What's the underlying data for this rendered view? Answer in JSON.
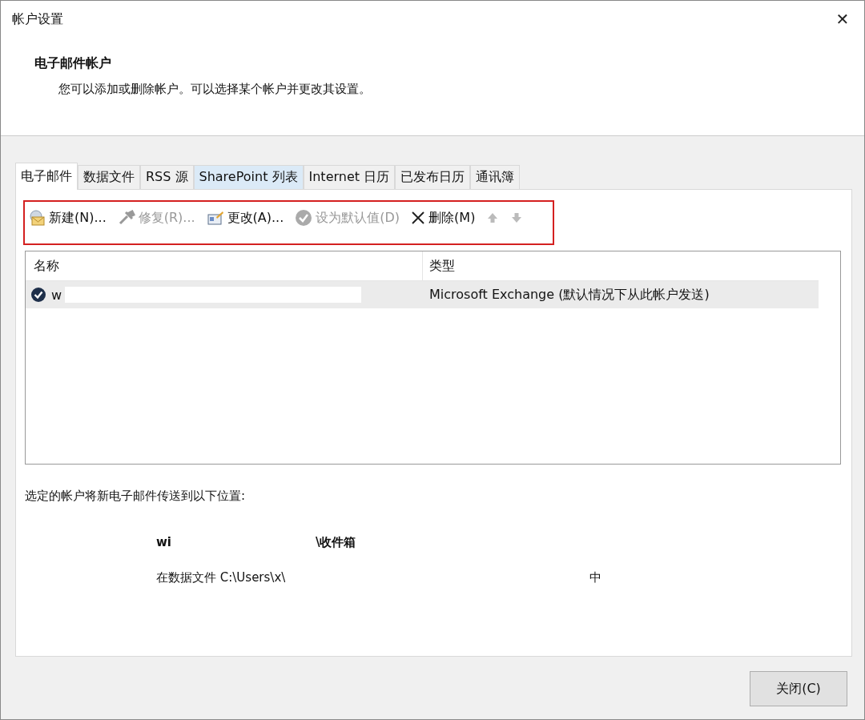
{
  "window": {
    "title": "帐户设置",
    "close_glyph": "✕"
  },
  "header": {
    "title": "电子邮件帐户",
    "description": "您可以添加或删除帐户。可以选择某个帐户并更改其设置。"
  },
  "tabs": [
    {
      "label": "电子邮件",
      "selected": true,
      "hover": false
    },
    {
      "label": "数据文件",
      "selected": false,
      "hover": false
    },
    {
      "label": "RSS 源",
      "selected": false,
      "hover": false
    },
    {
      "label": "SharePoint 列表",
      "selected": false,
      "hover": true
    },
    {
      "label": "Internet 日历",
      "selected": false,
      "hover": false
    },
    {
      "label": "已发布日历",
      "selected": false,
      "hover": false
    },
    {
      "label": "通讯簿",
      "selected": false,
      "hover": false
    }
  ],
  "toolbar": {
    "highlighted": true,
    "items": [
      {
        "kind": "new",
        "label": "新建(N)...",
        "disabled": false
      },
      {
        "kind": "repair",
        "label": "修复(R)...",
        "disabled": true
      },
      {
        "kind": "change",
        "label": "更改(A)...",
        "disabled": false
      },
      {
        "kind": "default",
        "label": "设为默认值(D)",
        "disabled": true
      },
      {
        "kind": "delete",
        "label": "删除(M)",
        "disabled": false
      },
      {
        "kind": "up",
        "disabled": true
      },
      {
        "kind": "down",
        "disabled": true
      }
    ]
  },
  "accounts": {
    "columns": [
      "名称",
      "类型"
    ],
    "rows": [
      {
        "name": "w",
        "redacted": true,
        "default": true,
        "selected": true,
        "type": "Microsoft Exchange (默认情况下从此帐户发送)"
      }
    ]
  },
  "delivery": {
    "label": "选定的帐户将新电子邮件传送到以下位置:",
    "folder_start": "wi",
    "folder_end": "\\收件箱",
    "path_start": "在数据文件 C:\\Users\\x\\",
    "path_end": "中"
  },
  "buttons": [
    {
      "label": "关闭(C)"
    }
  ]
}
